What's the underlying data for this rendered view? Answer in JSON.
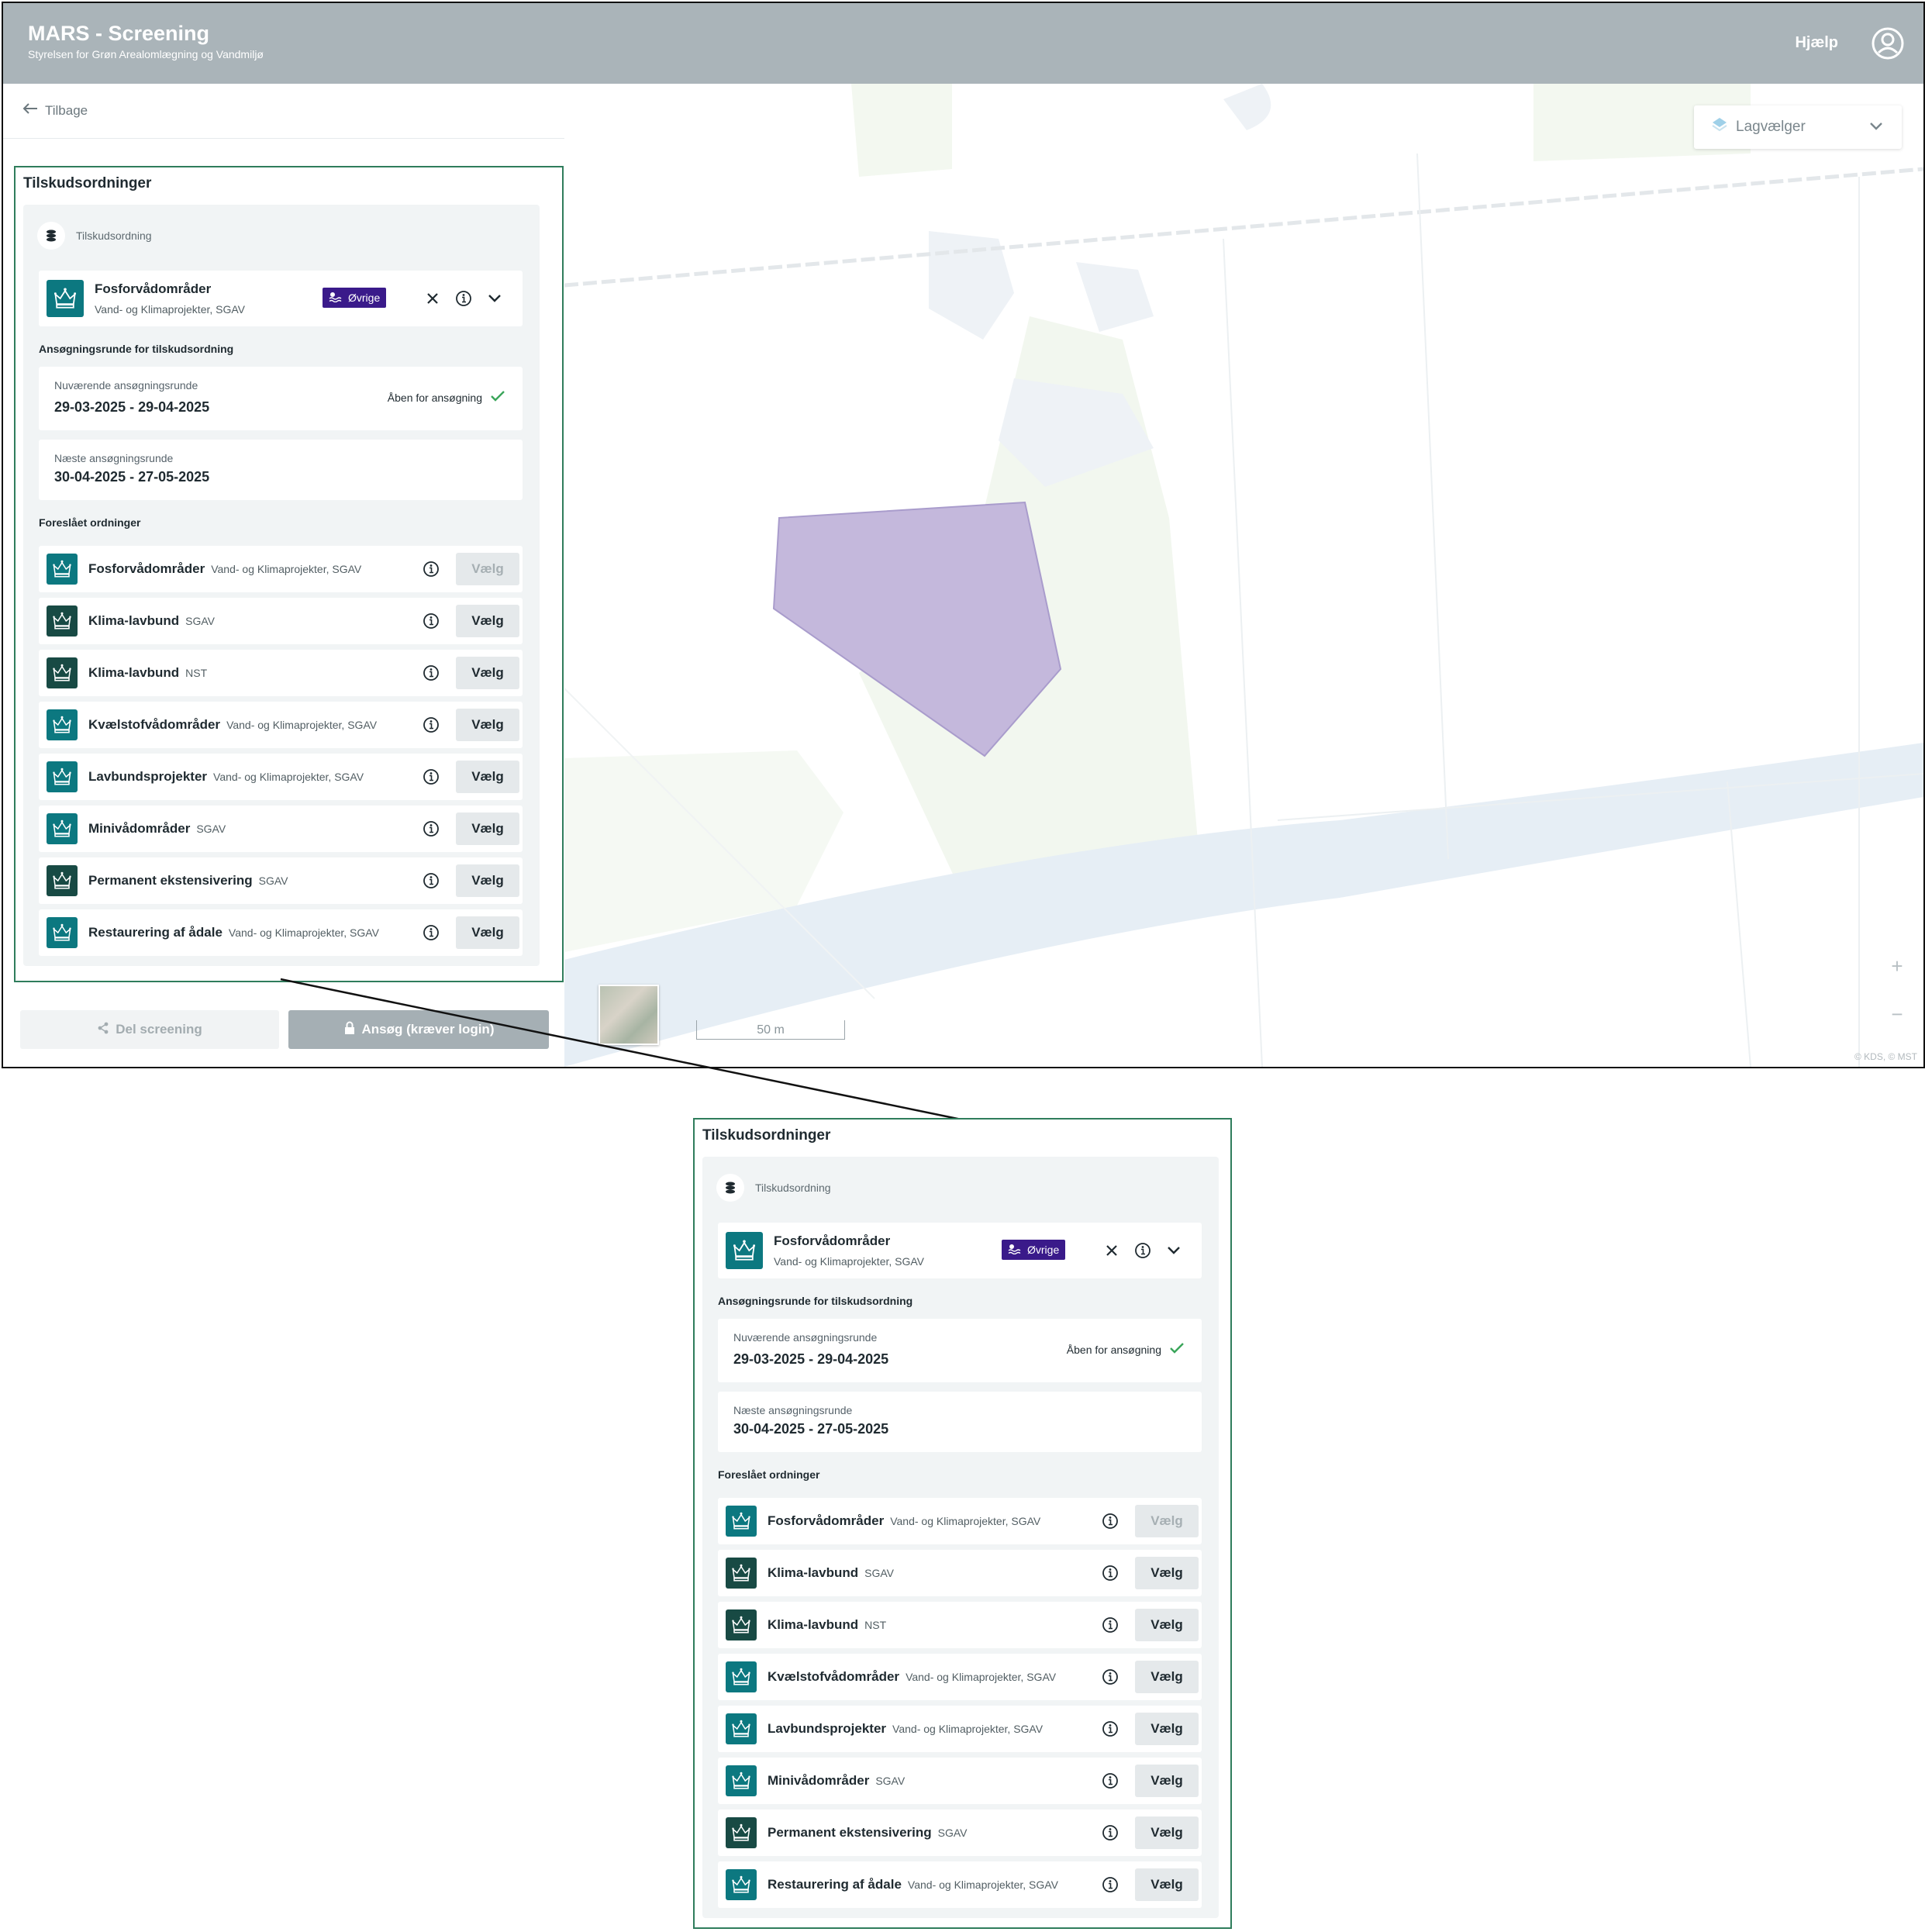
{
  "header": {
    "title": "MARS - Screening",
    "subtitle": "Styrelsen for Grøn Arealomlægning og Vandmiljø",
    "help_label": "Hjælp"
  },
  "sidebar": {
    "back_label": "Tilbage",
    "share_label": "Del screening",
    "apply_label": "Ansøg (kræver login)"
  },
  "panel": {
    "title": "Tilskudsordninger",
    "scheme_header": "Tilskudsordning",
    "selected": {
      "name": "Fosforvådområder",
      "org": "Vand- og Klimaprojekter, SGAV",
      "badge": "Øvrige"
    },
    "round_section_label": "Ansøgningsrunde for tilskudsordning",
    "current_round": {
      "caption": "Nuværende ansøgningsrunde",
      "dates": "29-03-2025 - 29-04-2025",
      "status": "Åben for ansøgning"
    },
    "next_round": {
      "caption": "Næste ansøgningsrunde",
      "dates": "30-04-2025 - 27-05-2025"
    },
    "suggested_label": "Foreslået ordninger",
    "choose_label": "Vælg",
    "options": [
      {
        "name": "Fosforvådområder",
        "org": "Vand- og Klimaprojekter, SGAV",
        "disabled": true,
        "color": "#0c7880"
      },
      {
        "name": "Klima-lavbund",
        "org": "SGAV",
        "disabled": false,
        "color": "#184a44"
      },
      {
        "name": "Klima-lavbund",
        "org": "NST",
        "disabled": false,
        "color": "#184a44"
      },
      {
        "name": "Kvælstofvådområder",
        "org": "Vand- og Klimaprojekter, SGAV",
        "disabled": false,
        "color": "#0c7880"
      },
      {
        "name": "Lavbundsprojekter",
        "org": "Vand- og Klimaprojekter, SGAV",
        "disabled": false,
        "color": "#0c7880"
      },
      {
        "name": "Minivådområder",
        "org": "SGAV",
        "disabled": false,
        "color": "#0c7880"
      },
      {
        "name": "Permanent ekstensivering",
        "org": "SGAV",
        "disabled": false,
        "color": "#184a44"
      },
      {
        "name": "Restaurering af ådale",
        "org": "Vand- og Klimaprojekter, SGAV",
        "disabled": false,
        "color": "#0c7880"
      }
    ]
  },
  "map": {
    "layer_picker_label": "Lagvælger",
    "scale_label": "50 m",
    "zoom_in": "+",
    "zoom_out": "−",
    "attribution": "© KDS, © MST"
  },
  "colors": {
    "header_bg": "#aab4b9",
    "panel_border": "#2f7d5c",
    "selection_polygon": "#c4b8dc",
    "water": "#e6eef5",
    "badge_purple": "#3a1a8a"
  }
}
